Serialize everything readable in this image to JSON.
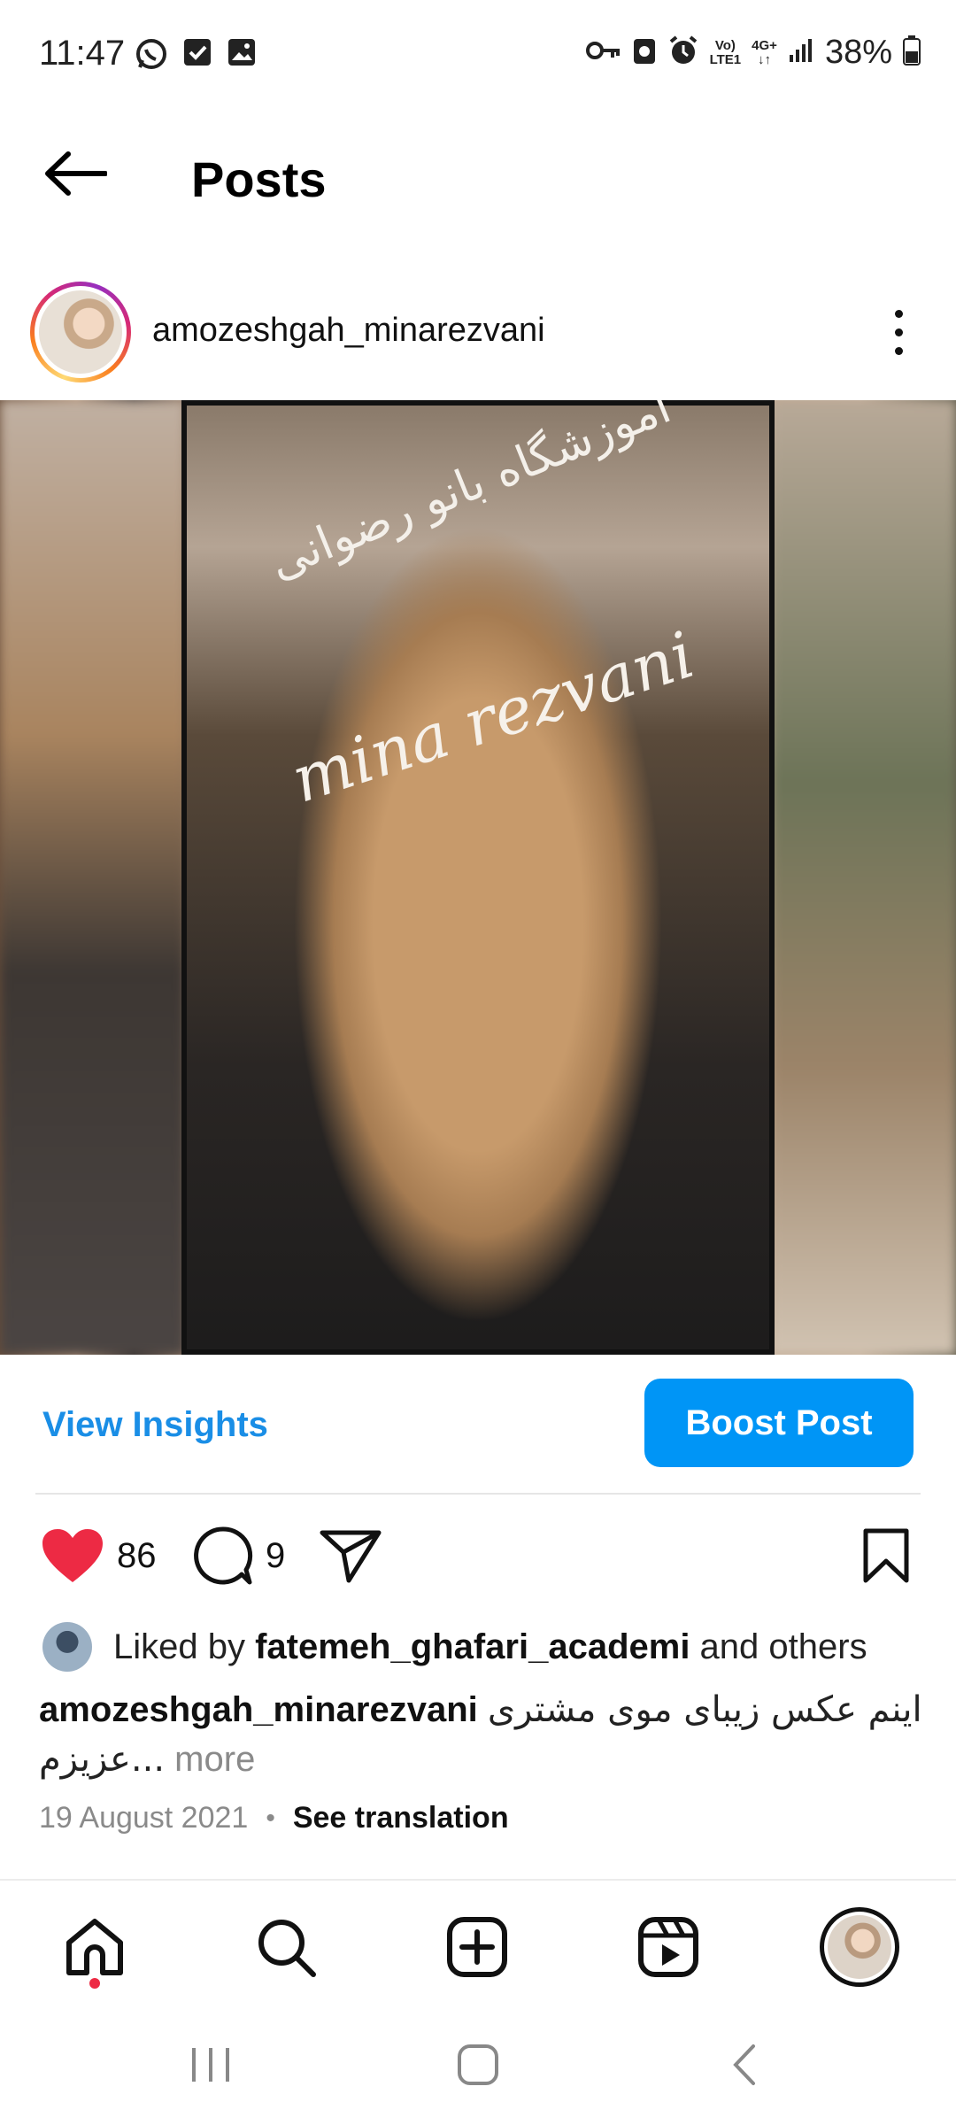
{
  "status_bar": {
    "time": "11:47",
    "left_icons": [
      "whatsapp-icon",
      "checkbox-icon",
      "gallery-icon"
    ],
    "right_icons": [
      "key-icon",
      "screenshot-icon",
      "alarm-icon",
      "volte-icon",
      "4g-icon",
      "signal-icon",
      "battery-icon"
    ],
    "volte_line1": "Vo)",
    "volte_line2": "LTE1",
    "network": "4G+",
    "battery": "38%"
  },
  "header": {
    "title": "Posts",
    "back_icon": "back-arrow-icon"
  },
  "post": {
    "username": "amozeshgah_minarezvani",
    "media": {
      "watermark_fa": "آموزشگاه بانو رضوانی",
      "watermark_en": "mina rezvani"
    },
    "view_insights": "View Insights",
    "boost_post": "Boost Post",
    "likes_count": "86",
    "comments_count": "9",
    "liked_by_prefix": "Liked by ",
    "liked_by_user": "fatemeh_ghafari_academi",
    "liked_by_suffix": " and others",
    "caption_user": "amozeshgah_minarezvani",
    "caption_text": "اینم عکس زیبای موی مشتری عزیزم...",
    "caption_more": " more",
    "date": "19 August 2021",
    "meta_separator": "•",
    "see_translation": "See translation"
  },
  "bottom_nav": [
    "home-icon",
    "search-icon",
    "create-icon",
    "reels-icon",
    "profile-avatar"
  ],
  "system_nav": [
    "recent-apps-icon",
    "home-button-icon",
    "back-icon"
  ],
  "colors": {
    "accent_blue": "#0095f6",
    "link_blue": "#1a8ee6",
    "like_red": "#ed2a44"
  }
}
